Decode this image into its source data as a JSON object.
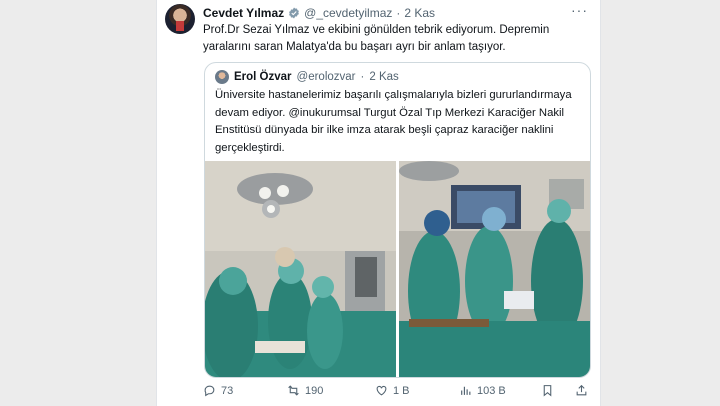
{
  "tweet": {
    "author_name": "Cevdet Yılmaz",
    "handle": "@_cevdetyilmaz",
    "separator": "·",
    "time": "2 Kas",
    "more_icon": "more-horizontal-icon",
    "text": "Prof.Dr Sezai Yılmaz ve ekibini gönülden tebrik ediyorum. Depremin yaralarını saran Malatya'da bu başarı ayrı bir anlam taşıyor."
  },
  "quote": {
    "author_name": "Erol Özvar",
    "handle": "@erolozvar",
    "separator": "·",
    "time": "2 Kas",
    "text": "Üniversite hastanelerimiz başarılı çalışmalarıyla bizleri gururlandırmaya devam ediyor. @inukurumsal Turgut Özal Tıp Merkezi Karaciğer Nakil Enstitüsü dünyada bir ilke imza atarak beşli çapraz karaciğer naklini gerçekleştirdi."
  },
  "actions": {
    "replies": "73",
    "retweets": "190",
    "likes": "1 B",
    "views": "103 B"
  },
  "icons": {
    "reply": "reply-icon",
    "retweet": "retweet-icon",
    "like": "heart-icon",
    "views": "views-chart-icon",
    "bookmark": "bookmark-icon",
    "share": "share-icon",
    "verified": "verified-badge-icon"
  },
  "colors": {
    "text": "#0f1419",
    "muted": "#536471",
    "border": "#cfd9de",
    "scrub_green": "#2f8a7e"
  }
}
